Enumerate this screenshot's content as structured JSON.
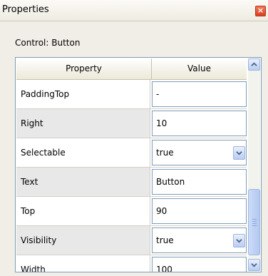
{
  "window": {
    "title": "Properties"
  },
  "panel": {
    "control_label": "Control: Button"
  },
  "grid": {
    "headers": {
      "property": "Property",
      "value": "Value"
    },
    "rows": [
      {
        "name": "PaddingTop",
        "value": "-",
        "type": "text"
      },
      {
        "name": "Right",
        "value": "10",
        "type": "text"
      },
      {
        "name": "Selectable",
        "value": "true",
        "type": "dropdown"
      },
      {
        "name": "Text",
        "value": "Button",
        "type": "text"
      },
      {
        "name": "Top",
        "value": "90",
        "type": "text"
      },
      {
        "name": "Visibility",
        "value": "true",
        "type": "dropdown"
      },
      {
        "name": "Width",
        "value": "100",
        "type": "text"
      }
    ]
  },
  "colors": {
    "close_button": "#d9401f",
    "grid_border": "#7f9db9",
    "row_alt": "#e8e8e8"
  },
  "icons": {
    "close": "close-icon",
    "dropdown": "chevron-down-icon",
    "scroll_up": "chevron-up-icon",
    "scroll_down": "chevron-down-icon"
  }
}
